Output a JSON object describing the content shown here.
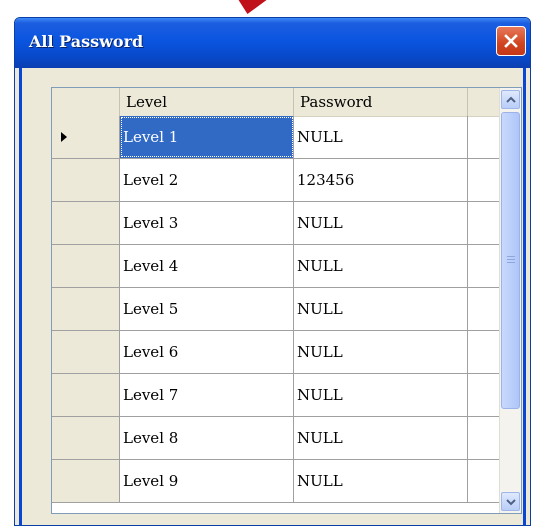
{
  "window": {
    "title": "All Password"
  },
  "grid": {
    "columns": [
      "Level",
      "Password"
    ],
    "rows": [
      {
        "level": "Level 1",
        "password": "NULL",
        "selected": true
      },
      {
        "level": "Level 2",
        "password": "123456"
      },
      {
        "level": "Level 3",
        "password": "NULL"
      },
      {
        "level": "Level 4",
        "password": "NULL"
      },
      {
        "level": "Level 5",
        "password": "NULL"
      },
      {
        "level": "Level 6",
        "password": "NULL"
      },
      {
        "level": "Level 7",
        "password": "NULL"
      },
      {
        "level": "Level 8",
        "password": "NULL"
      },
      {
        "level": "Level 9",
        "password": "NULL"
      }
    ]
  },
  "icons": {
    "close": "close-icon",
    "row_indicator": "row-indicator-arrow-icon",
    "scroll_up": "chevron-up-icon",
    "scroll_down": "chevron-down-icon"
  },
  "colors": {
    "titlebar": "#0a55e0",
    "selection": "#316ac5",
    "close_button": "#d1441f",
    "dialog_background": "#ece9d8"
  }
}
